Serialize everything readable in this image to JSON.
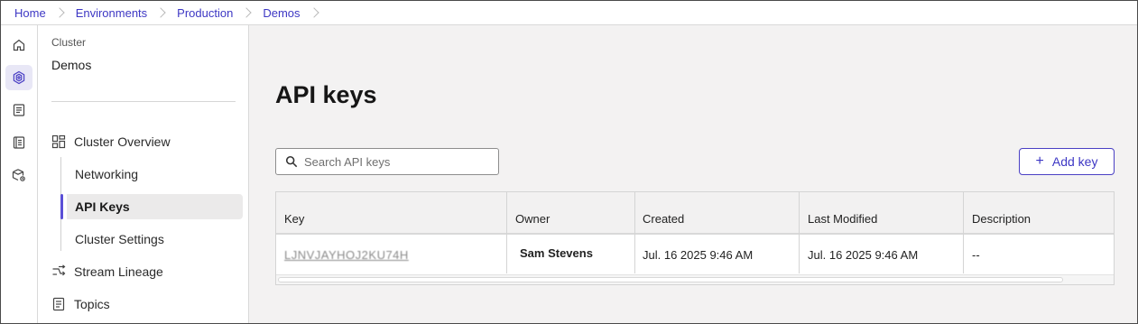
{
  "breadcrumb": [
    "Home",
    "Environments",
    "Production",
    "Demos"
  ],
  "rail": {
    "icons": [
      "home-icon",
      "cluster-icon",
      "document-icon",
      "catalog-icon",
      "connectors-icon"
    ],
    "active": "cluster-icon"
  },
  "panel": {
    "category": "Cluster",
    "name": "Demos",
    "items": {
      "overview": "Cluster Overview",
      "networking": "Networking",
      "api_keys": "API Keys",
      "settings": "Cluster Settings",
      "lineage": "Stream Lineage",
      "topics": "Topics"
    }
  },
  "main": {
    "title": "API keys",
    "search_placeholder": "Search API keys",
    "add_label": "Add key",
    "add_icon": "+",
    "table": {
      "headers": [
        "Key",
        "Owner",
        "Created",
        "Last Modified",
        "Description"
      ],
      "rows": [
        {
          "key": "LJNVJAYHOJ2KU74H",
          "owner": "Sam Stevens",
          "created": "Jul. 16 2025 9:46 AM",
          "modified": "Jul. 16 2025 9:46 AM",
          "description": "--"
        }
      ]
    }
  },
  "colors": {
    "accent": "#3d37c4",
    "active_marker": "#5a4fd6",
    "main_bg": "#f3f2f2"
  }
}
